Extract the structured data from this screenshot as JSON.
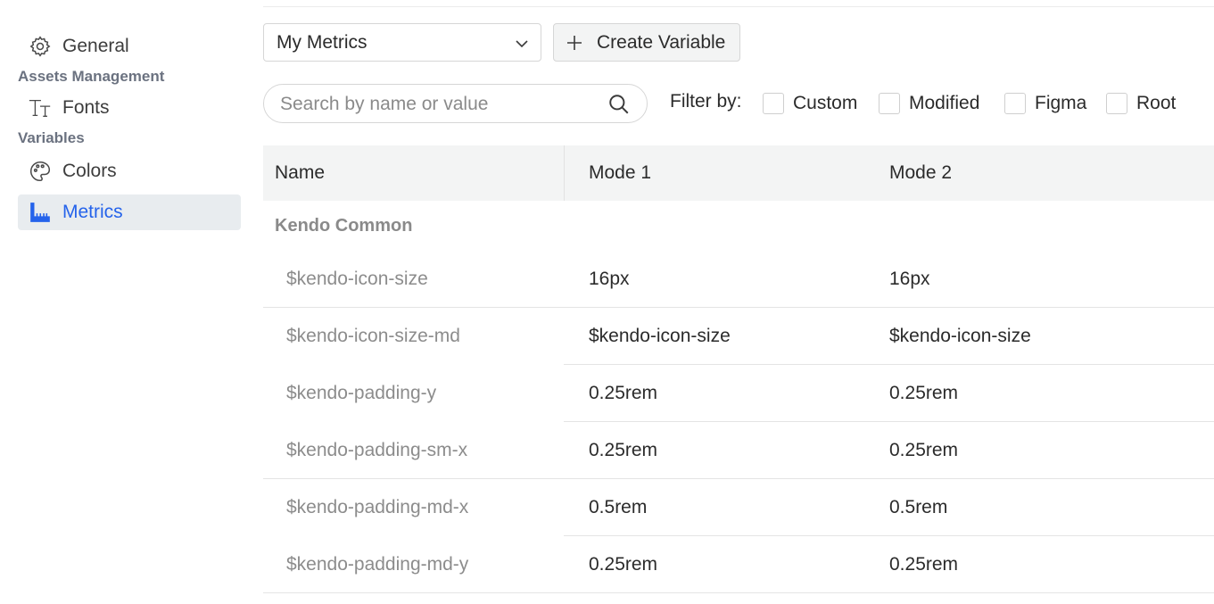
{
  "sidebar": {
    "general_label": "General",
    "assets_group_label": "Assets Management",
    "fonts_label": "Fonts",
    "variables_group_label": "Variables",
    "colors_label": "Colors",
    "metrics_label": "Metrics",
    "active_item": "Metrics",
    "icons": {
      "general": "gear-icon",
      "fonts": "text-size-icon",
      "colors": "palette-icon",
      "metrics": "ruler-icon"
    }
  },
  "toolbar": {
    "collection_select_value": "My Metrics",
    "create_variable_label": "Create Variable"
  },
  "search": {
    "placeholder": "Search by name or value",
    "value": ""
  },
  "filters": {
    "label": "Filter by:",
    "options": [
      {
        "label": "Custom",
        "checked": false
      },
      {
        "label": "Modified",
        "checked": false
      },
      {
        "label": "Figma",
        "checked": false
      },
      {
        "label": "Root",
        "checked": false
      }
    ]
  },
  "table": {
    "columns": [
      "Name",
      "Mode 1",
      "Mode 2"
    ],
    "group_name": "Kendo Common",
    "rows": [
      {
        "name": "$kendo-icon-size",
        "mode1": "16px",
        "mode2": "16px"
      },
      {
        "name": "$kendo-icon-size-md",
        "mode1": "$kendo-icon-size",
        "mode2": "$kendo-icon-size"
      },
      {
        "name": "$kendo-padding-y",
        "mode1": "0.25rem",
        "mode2": "0.25rem"
      },
      {
        "name": "$kendo-padding-sm-x",
        "mode1": "0.25rem",
        "mode2": "0.25rem"
      },
      {
        "name": "$kendo-padding-md-x",
        "mode1": "0.5rem",
        "mode2": "0.5rem"
      },
      {
        "name": "$kendo-padding-md-y",
        "mode1": "0.25rem",
        "mode2": "0.25rem"
      }
    ]
  },
  "colors": {
    "accent": "#2563eb",
    "active_bg": "#e8ecef",
    "header_bg": "#f3f4f4"
  }
}
